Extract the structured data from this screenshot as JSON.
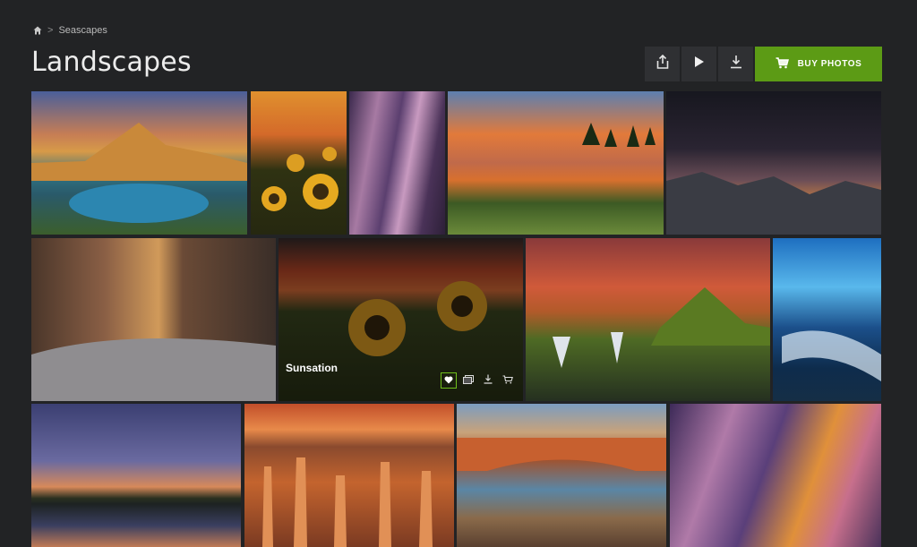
{
  "breadcrumb": {
    "home_icon": "home-icon",
    "separator": ">",
    "current": "Seascapes"
  },
  "page": {
    "title": "Landscapes"
  },
  "toolbar": {
    "share_icon": "share-icon",
    "slideshow_icon": "play-icon",
    "download_icon": "download-icon",
    "buy_label": "BUY PHOTOS",
    "buy_color": "#5c9b15"
  },
  "gallery": {
    "photos": [
      {
        "subject": "alpine lake at sunset",
        "colors": [
          "#4f6fa5",
          "#e1a24e",
          "#2a6a78",
          "#3e5a2a"
        ]
      },
      {
        "subject": "sunflowers",
        "colors": [
          "#d68a2b",
          "#3a3a15",
          "#e8b22a"
        ]
      },
      {
        "subject": "slot canyon",
        "colors": [
          "#5b3f6f",
          "#b889b0",
          "#3b2b4a"
        ]
      },
      {
        "subject": "meadow pond sunset",
        "colors": [
          "#e07d3a",
          "#6b8fb0",
          "#3d5a2a"
        ]
      },
      {
        "subject": "milky way over mountains",
        "colors": [
          "#1a1a26",
          "#4a3a4a",
          "#8a6c6a"
        ]
      },
      {
        "subject": "narrows river canyon",
        "colors": [
          "#6e4a35",
          "#b88b6a",
          "#3a3a3a"
        ]
      },
      {
        "subject": "sunflowers at sunset",
        "colors": [
          "#b54a2a",
          "#3d4a22",
          "#e2a92b"
        ],
        "caption": "Sunsation"
      },
      {
        "subject": "waterfall and mountain",
        "colors": [
          "#c45038",
          "#5a7a2a",
          "#2a2a24"
        ]
      },
      {
        "subject": "ice cave river",
        "colors": [
          "#1f6fbf",
          "#5ec0f0",
          "#0e2a4a"
        ]
      },
      {
        "subject": "lake at twilight",
        "colors": [
          "#3a3f70",
          "#d98a5a",
          "#1a2020"
        ]
      },
      {
        "subject": "hoodoo amphitheater",
        "colors": [
          "#c4582a",
          "#e89a5a",
          "#6a3a2a"
        ]
      },
      {
        "subject": "arch at sunrise",
        "colors": [
          "#8aa8c5",
          "#d06a3a",
          "#6a4a3a"
        ]
      },
      {
        "subject": "antelope canyon",
        "colors": [
          "#5a3f7a",
          "#c07aa5",
          "#e89a3a"
        ]
      }
    ],
    "hover_actions": {
      "favorite": "heart-icon",
      "gallery": "gallery-icon",
      "download": "download-icon",
      "cart": "cart-icon"
    }
  }
}
